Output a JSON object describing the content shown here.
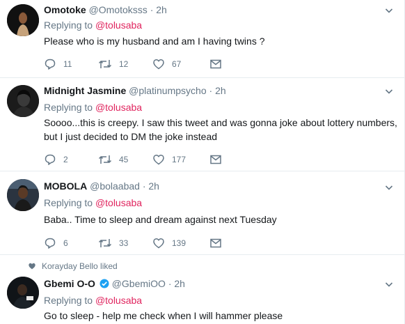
{
  "tweets": [
    {
      "name": "Omotoke",
      "handle": "@Omotoksss",
      "dot": "·",
      "time": "2h",
      "replying_prefix": "Replying to",
      "replying_to": "@tolusaba",
      "text": "Please who is my husband and am I having twins ?",
      "replies": "11",
      "retweets": "12",
      "likes": "67"
    },
    {
      "name": "Midnight Jasmine",
      "handle": "@platinumpsycho",
      "dot": "·",
      "time": "2h",
      "replying_prefix": "Replying to",
      "replying_to": "@tolusaba",
      "text": "Soooo...this is creepy. I saw this tweet and was gonna joke about lottery numbers, but I just decided to DM the joke instead",
      "replies": "2",
      "retweets": "45",
      "likes": "177"
    },
    {
      "name": "MOBOLA",
      "handle": "@bolaabad",
      "dot": "·",
      "time": "2h",
      "replying_prefix": "Replying to",
      "replying_to": "@tolusaba",
      "text": "Baba.. Time to sleep and dream against next Tuesday",
      "replies": "6",
      "retweets": "33",
      "likes": "139"
    },
    {
      "liked_by": "Korayday Bello liked",
      "name": "Gbemi O-O",
      "handle": "@GbemiOO",
      "dot": "·",
      "time": "2h",
      "verified": true,
      "replying_prefix": "Replying to",
      "replying_to": "@tolusaba",
      "text": "Go to sleep - help me check when I will hammer please"
    }
  ],
  "icons": {
    "reply": "reply-icon",
    "retweet": "retweet-icon",
    "like": "heart-icon",
    "dm": "envelope-icon",
    "caret": "chevron-down-icon",
    "verified": "verified-badge-icon"
  },
  "colors": {
    "mention": "#e0245e",
    "secondary_text": "#657786",
    "verified": "#1da1f2",
    "divider": "#e6ecf0"
  }
}
